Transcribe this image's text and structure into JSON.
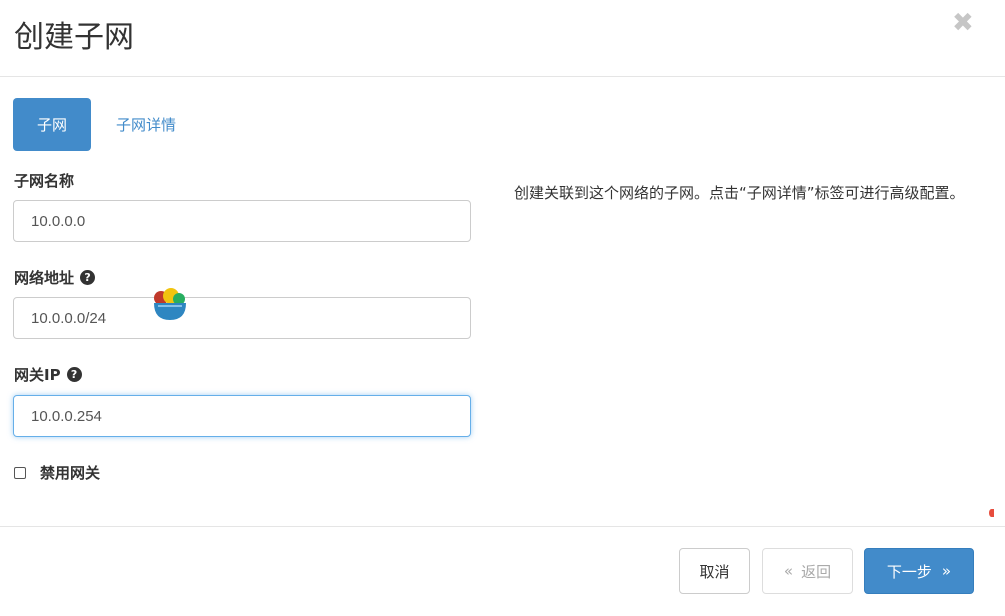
{
  "dialog": {
    "title": "创建子网",
    "close_symbol": "✖"
  },
  "tabs": [
    {
      "label": "子网",
      "active": true
    },
    {
      "label": "子网详情",
      "active": false
    }
  ],
  "form": {
    "subnet_name": {
      "label": "子网名称",
      "value": "10.0.0.0"
    },
    "network_address": {
      "label": "网络地址",
      "value": "10.0.0.0/24",
      "help_icon": "?"
    },
    "gateway_ip": {
      "label": "网关IP",
      "value": "10.0.0.254",
      "help_icon": "?"
    },
    "disable_gateway": {
      "label": "禁用网关",
      "checked": false
    }
  },
  "description": "创建关联到这个网络的子网。点击“子网详情”标签可进行高级配置。",
  "footer": {
    "cancel_label": "取消",
    "back_label": "返回",
    "back_symbol": "«",
    "next_label": "下一步",
    "next_symbol": "»"
  },
  "colors": {
    "primary": "#428bca",
    "focus_border": "#66afe9"
  }
}
